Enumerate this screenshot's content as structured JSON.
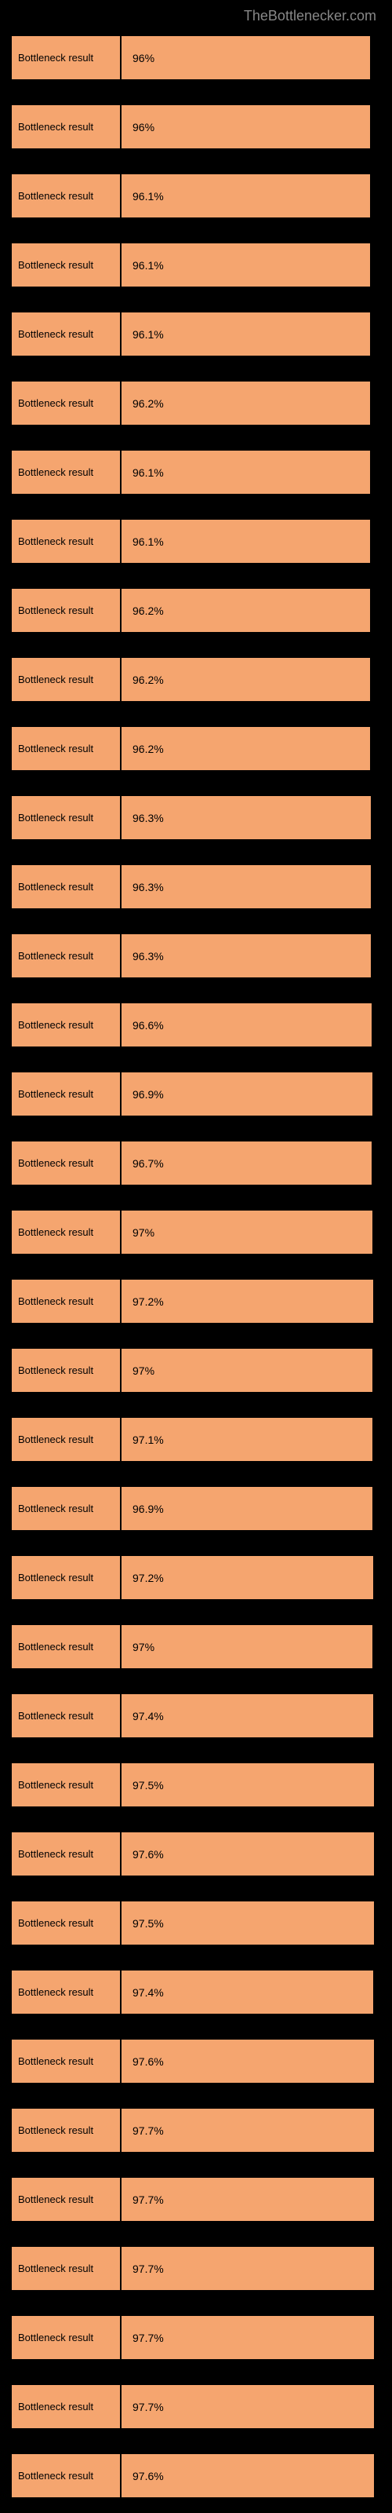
{
  "header": {
    "site_name": "TheBottlenecker.com"
  },
  "chart_data": {
    "type": "bar",
    "title": "TheBottlenecker.com",
    "xlabel": "",
    "ylabel": "",
    "ylim": [
      90,
      100
    ],
    "series": [
      {
        "name": "Bottleneck result",
        "value": 96.0,
        "label": "96%"
      },
      {
        "name": "Bottleneck result",
        "value": 96.0,
        "label": "96%"
      },
      {
        "name": "Bottleneck result",
        "value": 96.1,
        "label": "96.1%"
      },
      {
        "name": "Bottleneck result",
        "value": 96.1,
        "label": "96.1%"
      },
      {
        "name": "Bottleneck result",
        "value": 96.1,
        "label": "96.1%"
      },
      {
        "name": "Bottleneck result",
        "value": 96.2,
        "label": "96.2%"
      },
      {
        "name": "Bottleneck result",
        "value": 96.1,
        "label": "96.1%"
      },
      {
        "name": "Bottleneck result",
        "value": 96.1,
        "label": "96.1%"
      },
      {
        "name": "Bottleneck result",
        "value": 96.2,
        "label": "96.2%"
      },
      {
        "name": "Bottleneck result",
        "value": 96.2,
        "label": "96.2%"
      },
      {
        "name": "Bottleneck result",
        "value": 96.2,
        "label": "96.2%"
      },
      {
        "name": "Bottleneck result",
        "value": 96.3,
        "label": "96.3%"
      },
      {
        "name": "Bottleneck result",
        "value": 96.3,
        "label": "96.3%"
      },
      {
        "name": "Bottleneck result",
        "value": 96.3,
        "label": "96.3%"
      },
      {
        "name": "Bottleneck result",
        "value": 96.6,
        "label": "96.6%"
      },
      {
        "name": "Bottleneck result",
        "value": 96.9,
        "label": "96.9%"
      },
      {
        "name": "Bottleneck result",
        "value": 96.7,
        "label": "96.7%"
      },
      {
        "name": "Bottleneck result",
        "value": 97.0,
        "label": "97%"
      },
      {
        "name": "Bottleneck result",
        "value": 97.2,
        "label": "97.2%"
      },
      {
        "name": "Bottleneck result",
        "value": 97.0,
        "label": "97%"
      },
      {
        "name": "Bottleneck result",
        "value": 97.1,
        "label": "97.1%"
      },
      {
        "name": "Bottleneck result",
        "value": 96.9,
        "label": "96.9%"
      },
      {
        "name": "Bottleneck result",
        "value": 97.2,
        "label": "97.2%"
      },
      {
        "name": "Bottleneck result",
        "value": 97.0,
        "label": "97%"
      },
      {
        "name": "Bottleneck result",
        "value": 97.4,
        "label": "97.4%"
      },
      {
        "name": "Bottleneck result",
        "value": 97.5,
        "label": "97.5%"
      },
      {
        "name": "Bottleneck result",
        "value": 97.6,
        "label": "97.6%"
      },
      {
        "name": "Bottleneck result",
        "value": 97.5,
        "label": "97.5%"
      },
      {
        "name": "Bottleneck result",
        "value": 97.4,
        "label": "97.4%"
      },
      {
        "name": "Bottleneck result",
        "value": 97.6,
        "label": "97.6%"
      },
      {
        "name": "Bottleneck result",
        "value": 97.7,
        "label": "97.7%"
      },
      {
        "name": "Bottleneck result",
        "value": 97.7,
        "label": "97.7%"
      },
      {
        "name": "Bottleneck result",
        "value": 97.7,
        "label": "97.7%"
      },
      {
        "name": "Bottleneck result",
        "value": 97.7,
        "label": "97.7%"
      },
      {
        "name": "Bottleneck result",
        "value": 97.7,
        "label": "97.7%"
      },
      {
        "name": "Bottleneck result",
        "value": 97.6,
        "label": "97.6%"
      }
    ]
  },
  "colors": {
    "bar_fill": "#f5a56f",
    "background": "#000000",
    "header_text": "#888888"
  }
}
